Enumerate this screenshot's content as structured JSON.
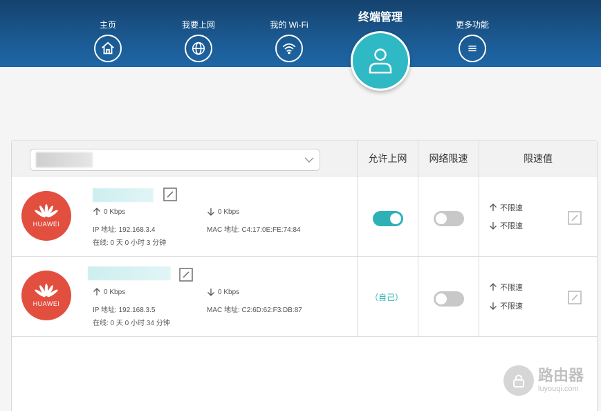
{
  "nav": {
    "items": [
      {
        "label": "主页",
        "icon": "home-icon"
      },
      {
        "label": "我要上网",
        "icon": "globe-icon"
      },
      {
        "label": "我的 Wi-Fi",
        "icon": "wifi-icon"
      },
      {
        "label": "终端管理",
        "icon": "user-icon",
        "active": true
      },
      {
        "label": "更多功能",
        "icon": "menu-icon"
      }
    ]
  },
  "table": {
    "headers": {
      "allow_internet": "允许上网",
      "speed_limit": "网络限速",
      "limit_value": "限速值"
    },
    "device_select": {
      "value": ""
    },
    "rows": [
      {
        "brand": "HUAWEI",
        "upload": "0 Kbps",
        "download": "0 Kbps",
        "ip": "IP 地址: 192.168.3.4",
        "mac": "MAC 地址: C4:17:0E:FE:74:84",
        "online": "在线: 0 天 0 小时 3 分钟",
        "allow_internet": true,
        "allow_label": "",
        "speed_limit_on": false,
        "up_limit": "不限速",
        "down_limit": "不限速"
      },
      {
        "brand": "HUAWEI",
        "upload": "0 Kbps",
        "download": "0 Kbps",
        "ip": "IP 地址: 192.168.3.5",
        "mac": "MAC 地址: C2:6D:62:F3:DB:87",
        "online": "在线: 0 天 0 小时 34 分钟",
        "allow_internet": null,
        "allow_label": "（自己）",
        "speed_limit_on": false,
        "up_limit": "不限速",
        "down_limit": "不限速"
      }
    ]
  },
  "watermark": {
    "title": "路由器",
    "subtitle": "luyouqi.com"
  },
  "colors": {
    "header": "#1b5a92",
    "accent": "#2fb9c4",
    "brand": "#e24f3f"
  }
}
